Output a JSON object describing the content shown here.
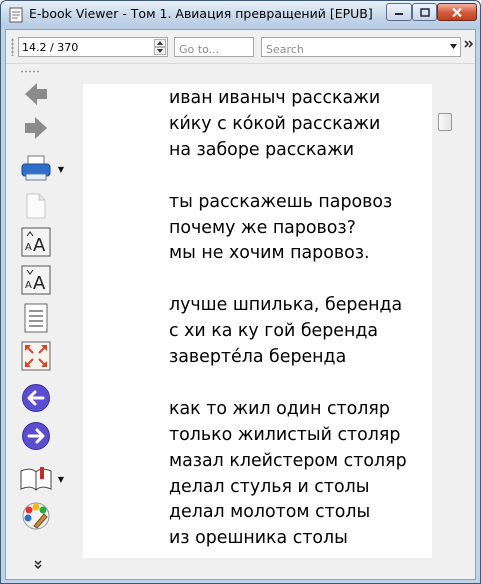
{
  "window": {
    "title": "E-book Viewer - Том 1. Авиация превращений [EPUB]"
  },
  "toolbar": {
    "position_value": "14.2 / 370",
    "goto_placeholder": "Go to...",
    "search_placeholder": "Search",
    "overflow_icon": "double-chevron-right-icon"
  },
  "side_tools": [
    {
      "name": "back-icon"
    },
    {
      "name": "forward-icon"
    },
    {
      "name": "print-icon"
    },
    {
      "name": "copy-icon"
    },
    {
      "name": "font-size-larger-icon"
    },
    {
      "name": "font-size-smaller-icon"
    },
    {
      "name": "toc-icon"
    },
    {
      "name": "fullscreen-icon"
    },
    {
      "name": "previous-page-icon"
    },
    {
      "name": "next-page-icon"
    },
    {
      "name": "bookmark-icon"
    },
    {
      "name": "preferences-icon"
    }
  ],
  "colors": {
    "nav_arrow": "#8b8b8b",
    "page_circle": "#5b4fd0",
    "print_blue": "#2f6fc9"
  },
  "book": {
    "stanzas": [
      {
        "lines": [
          "иван иваныч расскажи",
          "ки́ку с ко́кой расскажи",
          "на заборе расскажи"
        ]
      },
      {
        "lines": [
          "ты расскажешь паровоз",
          "почему же паровоз?",
          "мы не хочим паровоз."
        ]
      },
      {
        "lines": [
          "лучше шпилька, беренда",
          "с хи ка ку гой беренда",
          "заверте́ла беренда"
        ]
      },
      {
        "lines": [
          "как то жил один столяр",
          "только жилистый столяр",
          "мазал клейстером столяр",
          "делал стулья и столы",
          "делал молотом столы",
          "из орешника столы"
        ]
      }
    ]
  }
}
